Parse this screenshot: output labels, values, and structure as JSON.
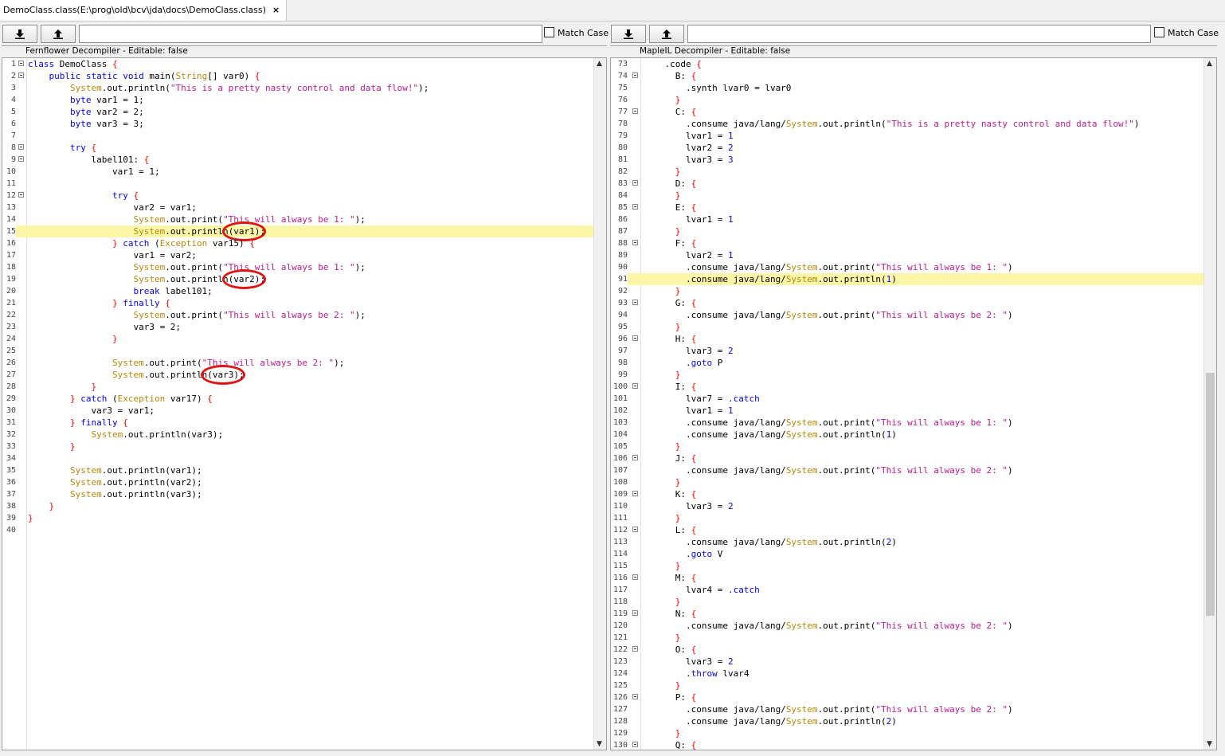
{
  "tab": {
    "title": "DemoClass.class(E:\\prog\\old\\bcv\\jda\\docs\\DemoClass.class)",
    "close": "×"
  },
  "left_panel": {
    "match_case": "Match Case",
    "title": "Fernflower Decompiler - Editable: false",
    "lines": [
      {
        "n": "1",
        "code": "class DemoClass {"
      },
      {
        "n": "2",
        "code": "    public static void main(String[] var0) {"
      },
      {
        "n": "3",
        "code": "        System.out.println(\"This is a pretty nasty control and data flow!\");"
      },
      {
        "n": "4",
        "code": "        byte var1 = 1;"
      },
      {
        "n": "5",
        "code": "        byte var2 = 2;"
      },
      {
        "n": "6",
        "code": "        byte var3 = 3;"
      },
      {
        "n": "7",
        "code": ""
      },
      {
        "n": "8",
        "code": "        try {"
      },
      {
        "n": "9",
        "code": "            label101: {"
      },
      {
        "n": "10",
        "code": "                var1 = 1;"
      },
      {
        "n": "11",
        "code": ""
      },
      {
        "n": "12",
        "code": "                try {"
      },
      {
        "n": "13",
        "code": "                    var2 = var1;"
      },
      {
        "n": "14",
        "code": "                    System.out.print(\"This will always be 1: \");"
      },
      {
        "n": "15",
        "code": "                    System.out.println(var1);"
      },
      {
        "n": "16",
        "code": "                } catch (Exception var15) {"
      },
      {
        "n": "17",
        "code": "                    var1 = var2;"
      },
      {
        "n": "18",
        "code": "                    System.out.print(\"This will always be 1: \");"
      },
      {
        "n": "19",
        "code": "                    System.out.println(var2);"
      },
      {
        "n": "20",
        "code": "                    break label101;"
      },
      {
        "n": "21",
        "code": "                } finally {"
      },
      {
        "n": "22",
        "code": "                    System.out.print(\"This will always be 2: \");"
      },
      {
        "n": "23",
        "code": "                    var3 = 2;"
      },
      {
        "n": "24",
        "code": "                }"
      },
      {
        "n": "25",
        "code": ""
      },
      {
        "n": "26",
        "code": "                System.out.print(\"This will always be 2: \");"
      },
      {
        "n": "27",
        "code": "                System.out.println(var3);"
      },
      {
        "n": "28",
        "code": "            }"
      },
      {
        "n": "29",
        "code": "        } catch (Exception var17) {"
      },
      {
        "n": "30",
        "code": "            var3 = var1;"
      },
      {
        "n": "31",
        "code": "        } finally {"
      },
      {
        "n": "32",
        "code": "            System.out.println(var3);"
      },
      {
        "n": "33",
        "code": "        }"
      },
      {
        "n": "34",
        "code": ""
      },
      {
        "n": "35",
        "code": "        System.out.println(var1);"
      },
      {
        "n": "36",
        "code": "        System.out.println(var2);"
      },
      {
        "n": "37",
        "code": "        System.out.println(var3);"
      },
      {
        "n": "38",
        "code": "    }"
      },
      {
        "n": "39",
        "code": "}"
      },
      {
        "n": "40",
        "code": ""
      }
    ]
  },
  "right_panel": {
    "match_case": "Match Case",
    "title": "MapleIL Decompiler - Editable: false",
    "lines": [
      {
        "n": "73",
        "code": "    .code {"
      },
      {
        "n": "74",
        "code": "      B: {"
      },
      {
        "n": "75",
        "code": "        .synth lvar0 = lvar0"
      },
      {
        "n": "76",
        "code": "      }"
      },
      {
        "n": "77",
        "code": "      C: {"
      },
      {
        "n": "78",
        "code": "        .consume java/lang/System.out.println(\"This is a pretty nasty control and data flow!\")"
      },
      {
        "n": "79",
        "code": "        lvar1 = 1"
      },
      {
        "n": "80",
        "code": "        lvar2 = 2"
      },
      {
        "n": "81",
        "code": "        lvar3 = 3"
      },
      {
        "n": "82",
        "code": "      }"
      },
      {
        "n": "83",
        "code": "      D: {"
      },
      {
        "n": "84",
        "code": "      }"
      },
      {
        "n": "85",
        "code": "      E: {"
      },
      {
        "n": "86",
        "code": "        lvar1 = 1"
      },
      {
        "n": "87",
        "code": "      }"
      },
      {
        "n": "88",
        "code": "      F: {"
      },
      {
        "n": "89",
        "code": "        lvar2 = 1"
      },
      {
        "n": "90",
        "code": "        .consume java/lang/System.out.print(\"This will always be 1: \")"
      },
      {
        "n": "91",
        "code": "        .consume java/lang/System.out.println(1)"
      },
      {
        "n": "92",
        "code": "      }"
      },
      {
        "n": "93",
        "code": "      G: {"
      },
      {
        "n": "94",
        "code": "        .consume java/lang/System.out.print(\"This will always be 2: \")"
      },
      {
        "n": "95",
        "code": "      }"
      },
      {
        "n": "96",
        "code": "      H: {"
      },
      {
        "n": "97",
        "code": "        lvar3 = 2"
      },
      {
        "n": "98",
        "code": "        .goto P"
      },
      {
        "n": "99",
        "code": "      }"
      },
      {
        "n": "100",
        "code": "      I: {"
      },
      {
        "n": "101",
        "code": "        lvar7 = .catch"
      },
      {
        "n": "102",
        "code": "        lvar1 = 1"
      },
      {
        "n": "103",
        "code": "        .consume java/lang/System.out.print(\"This will always be 1: \")"
      },
      {
        "n": "104",
        "code": "        .consume java/lang/System.out.println(1)"
      },
      {
        "n": "105",
        "code": "      }"
      },
      {
        "n": "106",
        "code": "      J: {"
      },
      {
        "n": "107",
        "code": "        .consume java/lang/System.out.print(\"This will always be 2: \")"
      },
      {
        "n": "108",
        "code": "      }"
      },
      {
        "n": "109",
        "code": "      K: {"
      },
      {
        "n": "110",
        "code": "        lvar3 = 2"
      },
      {
        "n": "111",
        "code": "      }"
      },
      {
        "n": "112",
        "code": "      L: {"
      },
      {
        "n": "113",
        "code": "        .consume java/lang/System.out.println(2)"
      },
      {
        "n": "114",
        "code": "        .goto V"
      },
      {
        "n": "115",
        "code": "      }"
      },
      {
        "n": "116",
        "code": "      M: {"
      },
      {
        "n": "117",
        "code": "        lvar4 = .catch"
      },
      {
        "n": "118",
        "code": "      }"
      },
      {
        "n": "119",
        "code": "      N: {"
      },
      {
        "n": "120",
        "code": "        .consume java/lang/System.out.print(\"This will always be 2: \")"
      },
      {
        "n": "121",
        "code": "      }"
      },
      {
        "n": "122",
        "code": "      O: {"
      },
      {
        "n": "123",
        "code": "        lvar3 = 2"
      },
      {
        "n": "124",
        "code": "        .throw lvar4"
      },
      {
        "n": "125",
        "code": "      }"
      },
      {
        "n": "126",
        "code": "      P: {"
      },
      {
        "n": "127",
        "code": "        .consume java/lang/System.out.print(\"This will always be 2: \")"
      },
      {
        "n": "128",
        "code": "        .consume java/lang/System.out.println(2)"
      },
      {
        "n": "129",
        "code": "      }"
      },
      {
        "n": "130",
        "code": "      Q: {"
      }
    ]
  },
  "icons": {
    "save": "download-arrow-icon",
    "open": "upload-arrow-icon"
  },
  "colors": {
    "keyword": "#0000ff",
    "string": "#c2188b",
    "class": "#b5880a",
    "brace": "#ff0000",
    "highlight": "#fbf6a8",
    "marker": "#e11313"
  }
}
